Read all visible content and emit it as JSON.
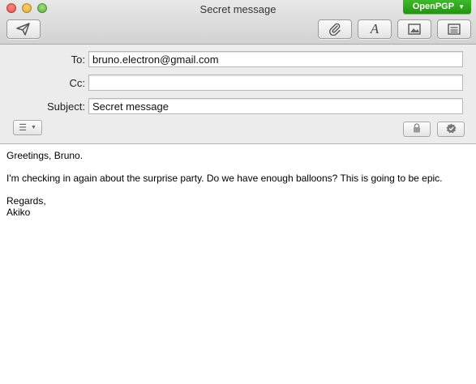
{
  "window": {
    "title": "Secret message",
    "openpgp_label": "OpenPGP",
    "openpgp_caret": "▼",
    "accent_color": "#2a9d18"
  },
  "toolbar": {
    "send_icon": "paper-plane-icon",
    "attach_icon": "paperclip-icon",
    "format_icon": "font-icon",
    "photo_icon": "photo-browser-icon",
    "template_icon": "header-options-icon"
  },
  "headers": {
    "to_label": "To:",
    "to_value": "bruno.electron@gmail.com",
    "cc_label": "Cc:",
    "cc_value": "",
    "subject_label": "Subject:",
    "subject_value": "Secret message",
    "options_menu_glyph": "☰",
    "options_menu_caret": "▼"
  },
  "message": {
    "greeting": "Greetings, Bruno.",
    "paragraph": "I'm checking in again about the surprise party. Do we have enough balloons? This is going to be epic.",
    "signoff": "Regards,",
    "signature": "Akiko"
  }
}
